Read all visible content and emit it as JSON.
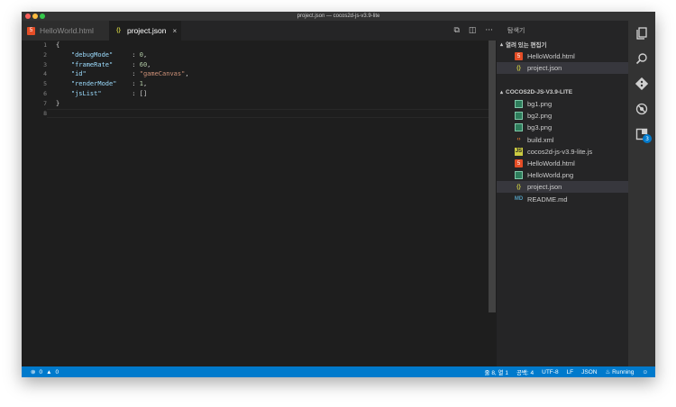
{
  "window": {
    "title": "project.json — cocos2d-js-v3.9-lite"
  },
  "tabs": [
    {
      "label": "HelloWorld.html",
      "icon": "html-file-icon",
      "active": false
    },
    {
      "label": "project.json",
      "icon": "json-file-icon",
      "active": true,
      "close": "×"
    }
  ],
  "tab_actions": {
    "compare_icon": "⧉",
    "split_icon": "◫",
    "more_icon": "···"
  },
  "editor": {
    "line_numbers": [
      "1",
      "2",
      "3",
      "4",
      "5",
      "6",
      "7",
      "8"
    ],
    "lines": [
      {
        "indent": "",
        "key": "",
        "sep": "",
        "value": "{",
        "value_type": "punct",
        "tail": ""
      },
      {
        "indent": "    ",
        "key": "\"debugMode\"",
        "sep": "     : ",
        "value": "0",
        "value_type": "num",
        "tail": ","
      },
      {
        "indent": "    ",
        "key": "\"frameRate\"",
        "sep": "     : ",
        "value": "60",
        "value_type": "num",
        "tail": ","
      },
      {
        "indent": "    ",
        "key": "\"id\"",
        "sep": "            : ",
        "value": "\"gameCanvas\"",
        "value_type": "str",
        "tail": ","
      },
      {
        "indent": "    ",
        "key": "\"renderMode\"",
        "sep": "    : ",
        "value": "1",
        "value_type": "num",
        "tail": ","
      },
      {
        "indent": "    ",
        "key": "\"jsList\"",
        "sep": "        : ",
        "value": "[]",
        "value_type": "punct",
        "tail": ""
      },
      {
        "indent": "",
        "key": "",
        "sep": "",
        "value": "}",
        "value_type": "punct",
        "tail": ""
      },
      {
        "indent": "",
        "key": "",
        "sep": "",
        "value": "",
        "value_type": "punct",
        "tail": ""
      }
    ]
  },
  "explorer": {
    "title": "탐색기",
    "open_editors_label": "열려 있는 편집기",
    "open_editors": [
      {
        "label": "HelloWorld.html",
        "icon": "html",
        "selected": false
      },
      {
        "label": "project.json",
        "icon": "json",
        "selected": true
      }
    ],
    "folder_label": "COCOS2D-JS-V3.9-LITE",
    "files": [
      {
        "label": "bg1.png",
        "icon": "png",
        "selected": false
      },
      {
        "label": "bg2.png",
        "icon": "png",
        "selected": false
      },
      {
        "label": "bg3.png",
        "icon": "png",
        "selected": false
      },
      {
        "label": "build.xml",
        "icon": "xml",
        "selected": false
      },
      {
        "label": "cocos2d-js-v3.9-lite.js",
        "icon": "js",
        "selected": false
      },
      {
        "label": "HelloWorld.html",
        "icon": "html",
        "selected": false
      },
      {
        "label": "HelloWorld.png",
        "icon": "png",
        "selected": false
      },
      {
        "label": "project.json",
        "icon": "json",
        "selected": true
      },
      {
        "label": "README.md",
        "icon": "md",
        "selected": false
      }
    ]
  },
  "activity_bar": {
    "items": [
      "files-icon",
      "search-icon",
      "git-icon",
      "debug-icon",
      "extensions-icon"
    ],
    "extensions_badge": "3"
  },
  "statusbar": {
    "errors": "0",
    "warnings": "0",
    "position": "줄 8, 열 1",
    "indent": "공백: 4",
    "encoding": "UTF-8",
    "eol": "LF",
    "language": "JSON",
    "running": "Running",
    "feedback_icon": "☺"
  },
  "colors": {
    "accent": "#007acc",
    "editor_bg": "#1e1e1e",
    "sidebar_bg": "#252526"
  }
}
